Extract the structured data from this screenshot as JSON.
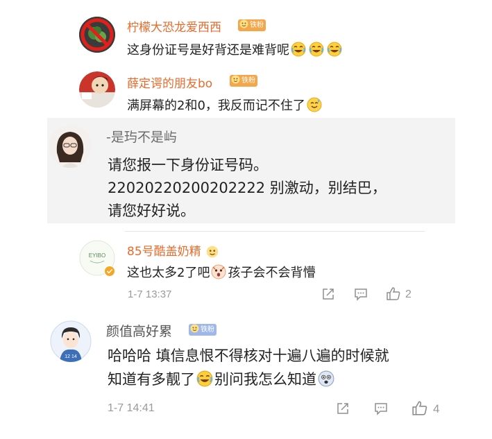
{
  "comments": [
    {
      "author": "柠檬大恐龙爱西西",
      "badge": "铁粉",
      "text": "这身份证号是好背还是难背呢",
      "emoji_count": 3
    },
    {
      "author": "薛定谔的朋友bo",
      "badge": "铁粉",
      "text": "满屏幕的2和0，我反而记不住了"
    },
    {
      "author": "-是玙不是屿",
      "lines": [
        "请您报一下身份证号码。",
        "22020220200202222 别激动，别结巴，",
        "请您好好说。"
      ]
    },
    {
      "author": "85号酷盖奶精",
      "avatar_text": "EYIBO",
      "text_before": "这也太多2了吧",
      "text_after": "孩子会不会背懵",
      "time": "1-7 13:37",
      "likes": "2"
    },
    {
      "author": "颜值高好累",
      "badge": "铁粉",
      "avatar_text": "12 14",
      "lines": [
        "哈哈哈 填信息恨不得核对十遍八遍的时候就",
        "知道有多靓了",
        "别问我怎么知道"
      ],
      "time": "1-7 14:41",
      "likes": "4"
    }
  ],
  "icons": [
    "share-icon",
    "comment-icon",
    "like-icon",
    "laugh-cry-emoji",
    "sweat-smile-emoji",
    "fan-badge-icon",
    "verified-icon"
  ],
  "colors": {
    "name_orange": "#e86b2c",
    "badge_orange": "#f3a64a",
    "badge_blue": "#9fb8e8",
    "highlight_bg": "#f3f3f3"
  }
}
